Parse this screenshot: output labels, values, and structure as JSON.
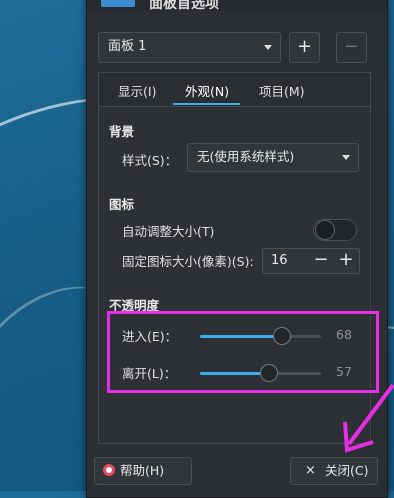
{
  "dialog": {
    "title": "面板首选项",
    "panel_select": {
      "value": "面板 1"
    },
    "add_button": "+",
    "remove_button": "−",
    "tabs": [
      {
        "label": "显示(I)"
      },
      {
        "label": "外观(N)"
      },
      {
        "label": "项目(M)"
      }
    ],
    "background_section": {
      "title": "背景",
      "style_label": "样式(S)：",
      "style_value": "无(使用系统样式)"
    },
    "icons_section": {
      "title": "图标",
      "auto_size_label": "自动调整大小(T)",
      "auto_size_on": false,
      "fixed_size_label": "固定图标大小(像素)(S):",
      "fixed_size_value": "16",
      "minus": "−",
      "plus": "+"
    },
    "opacity_section": {
      "title": "不透明度",
      "enter_label": "进入(E)：",
      "enter_value": "68",
      "enter_level": 68,
      "leave_label": "离开(L)：",
      "leave_value": "57",
      "leave_level": 57
    },
    "help_button": "帮助(H)",
    "close_button": "关闭(C)",
    "close_symbol": "×"
  },
  "colors": {
    "accent": "#3daee9",
    "highlight": "#e62ee6",
    "help_icon": "#e74c5c"
  }
}
